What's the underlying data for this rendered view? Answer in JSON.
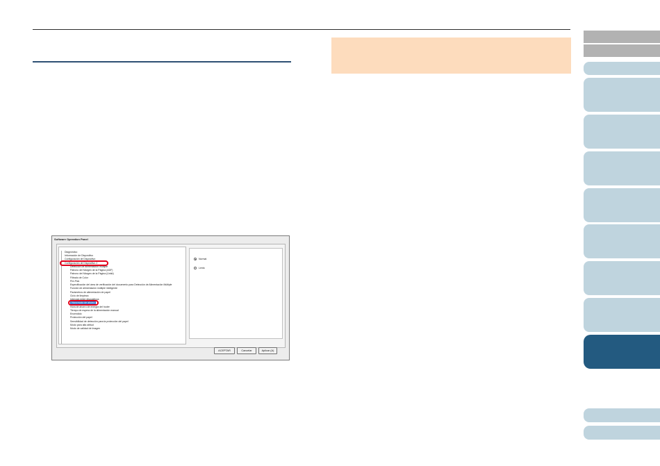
{
  "dialog": {
    "title": "Software Operation Panel",
    "tree_items": [
      "Diagnóstico",
      "Información de Dispositivo",
      "Configuración de Dispositivo",
      "Configuración de Dispositivo 2",
      "Detección de alimentación múltiple",
      "Patrono del Margen de la Página (ADF)",
      "Patrono del Margen de la Página (Unitd)",
      "Filtrado de Color",
      "Pre-Pick",
      "Especificación del área de verificación del documento para Detección de Alimentación Múltiple",
      "Función de alimentación múltiple inteligente",
      "Parámetros de alimentación de papel",
      "Ciclo de limpieza",
      "Intervalo entre dispositivos",
      "Hora modo de ahorro",
      "Hora de ahorro de energía del hoder",
      "Tiempo de espera de la alimentación manual",
      "Encendido",
      "Protección del papel",
      "Sensibilidad de detección para la protección del papel",
      "Modo para alta altitud",
      "Modo de calidad de Imagen"
    ],
    "options": {
      "normal": "Normal",
      "lento": "Lento"
    },
    "buttons": {
      "ok": "ACEPTAR",
      "cancel": "Cancelar",
      "apply": "Aplicar (A)"
    }
  },
  "colors": {
    "accent": "#235a80",
    "tab_light": "#bfd4de",
    "tab_gray": "#b2b2b2",
    "note_bg": "#fddcbd",
    "highlight": "#e2001a",
    "rule": "#2d4f73"
  }
}
